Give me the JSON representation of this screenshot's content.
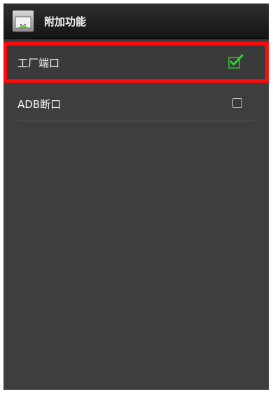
{
  "header": {
    "title": "附加功能",
    "app_icon": "android-app-icon"
  },
  "settings": {
    "items": [
      {
        "label": "工厂端口",
        "checked": true
      },
      {
        "label": "ADB断口",
        "checked": false
      }
    ]
  },
  "colors": {
    "highlight": "#ff0a0a",
    "check": "#27c227",
    "background": "#3e3e3e"
  }
}
